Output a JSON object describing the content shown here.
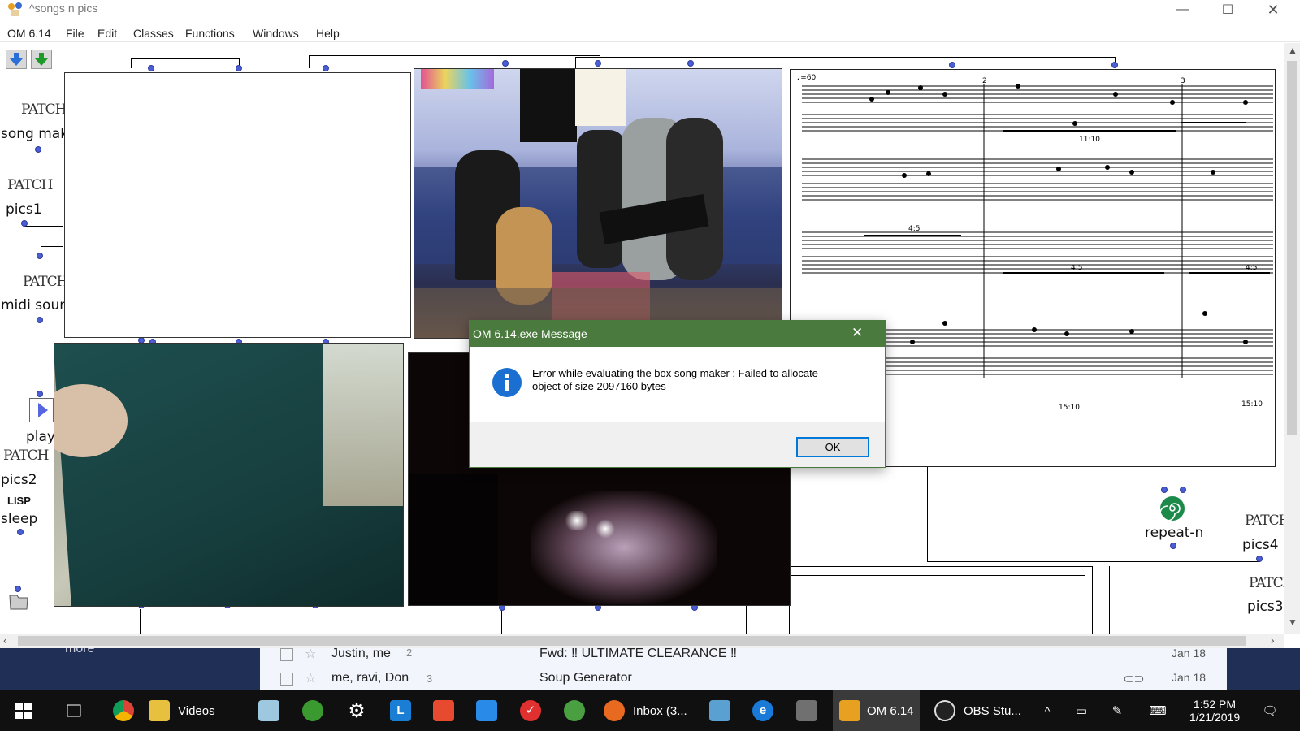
{
  "window": {
    "title": "^songs n pics",
    "controls": {
      "minimize": "—",
      "maximize": "☐",
      "close": "✕"
    }
  },
  "menu": [
    "OM 6.14",
    "File",
    "Edit",
    "Classes",
    "Functions",
    "Windows",
    "Help"
  ],
  "canvas": {
    "patch_icon_text": "PATCH",
    "lisp_icon_text": "LISP",
    "boxes": {
      "song_maker": "song make",
      "pics1": "pics1",
      "midi_sound": "midi sound",
      "play": "play",
      "pics2": "pics2",
      "sleep": "sleep",
      "repeat_n": "repeat-n",
      "pics4": "pics4",
      "pics3": "pics3"
    },
    "score": {
      "tempo_mark": "♩=60",
      "measure_numbers": [
        "2",
        "3"
      ],
      "tuplets": [
        "11:10",
        "4:5",
        "4:5",
        "4:5",
        "15:10",
        "15:10"
      ]
    }
  },
  "dialog": {
    "title": "OM 6.14.exe Message",
    "message_line1": "Error while evaluating the box song maker : Failed to allocate",
    "message_line2": "object of size 2097160 bytes",
    "ok": "OK",
    "close": "✕"
  },
  "email_strip": {
    "partial_top": "more",
    "rows": [
      {
        "from": "Justin, me",
        "count": "2",
        "subject": "Fwd: ‼ ULTIMATE CLEARANCE ‼",
        "date": "Jan 18"
      },
      {
        "from": "me, ravi, Don",
        "count": "3",
        "subject": "Soup Generator",
        "date": "Jan 18"
      }
    ]
  },
  "taskbar": {
    "videos": "Videos",
    "inbox": "Inbox (3...",
    "om": "OM 6.14",
    "obs": "OBS Stu...",
    "time": "1:52 PM",
    "date": "1/21/2019"
  },
  "colors": {
    "dialog_title": "#4b7a3f",
    "inlet_dot": "#4a5fd6",
    "taskbar": "#101010",
    "active_task": "#3a3a3a"
  }
}
